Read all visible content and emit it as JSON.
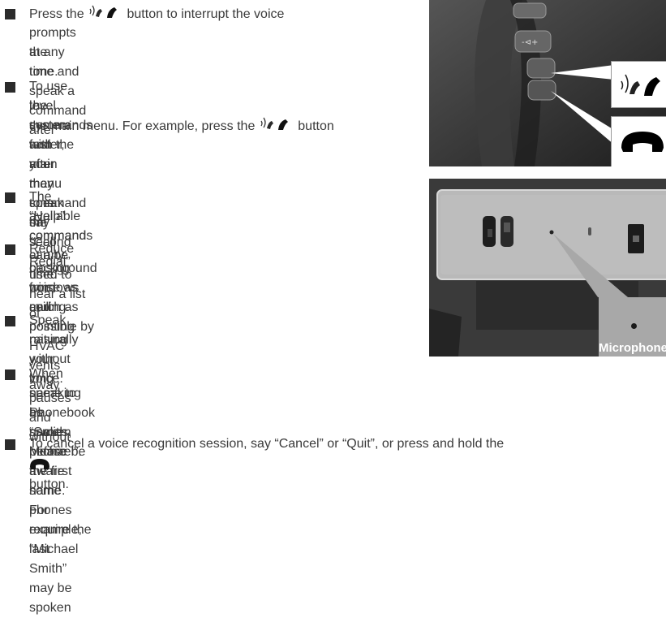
{
  "bullets": [
    {
      "text_a": "Press the",
      "text_b": "button to interrupt the voice",
      "lines": [
        "prompts at any time and speak a command after",
        "the tone."
      ]
    },
    {
      "lines": [
        "To use the system faster, you may speak the second",
        "level commands with the main menu command on"
      ],
      "line3_a": "the main menu. For example, press the",
      "line3_b": "button",
      "line4": "and after the tone say “Call Redial”."
    },
    {
      "lines": [
        "The “Help” command can be used to hear a list of",
        "available commands at any time."
      ]
    },
    {
      "lines": [
        "Reduce background noise as much as possible by",
        "closing windows and pointing HVAC vents away",
        "from ceiling."
      ]
    },
    {
      "lines": [
        "Speak naturally without long pauses and without",
        "raising your voice."
      ]
    },
    {
      "lines": [
        "When speaking Phonebook names, please be aware some phones require the last",
        "name to be spoken before the first name. For example, “Michael Smith” may be spoken",
        "as “Smith Michael”."
      ]
    },
    {
      "lines": [
        "To cancel a voice recognition session, say “Cancel” or “Quit”, or press and hold the"
      ],
      "last_b": "button."
    }
  ],
  "photos": {
    "microphone_label": "Microphone"
  },
  "icons": {
    "talk": "voice-talk-icon",
    "hangup": "phone-hangup-icon",
    "microphone": "microphone-dot-icon"
  },
  "colors": {
    "text": "#3a3a3a",
    "bullet": "#2b2b2b",
    "callout_gray": "#a8a8a8"
  }
}
